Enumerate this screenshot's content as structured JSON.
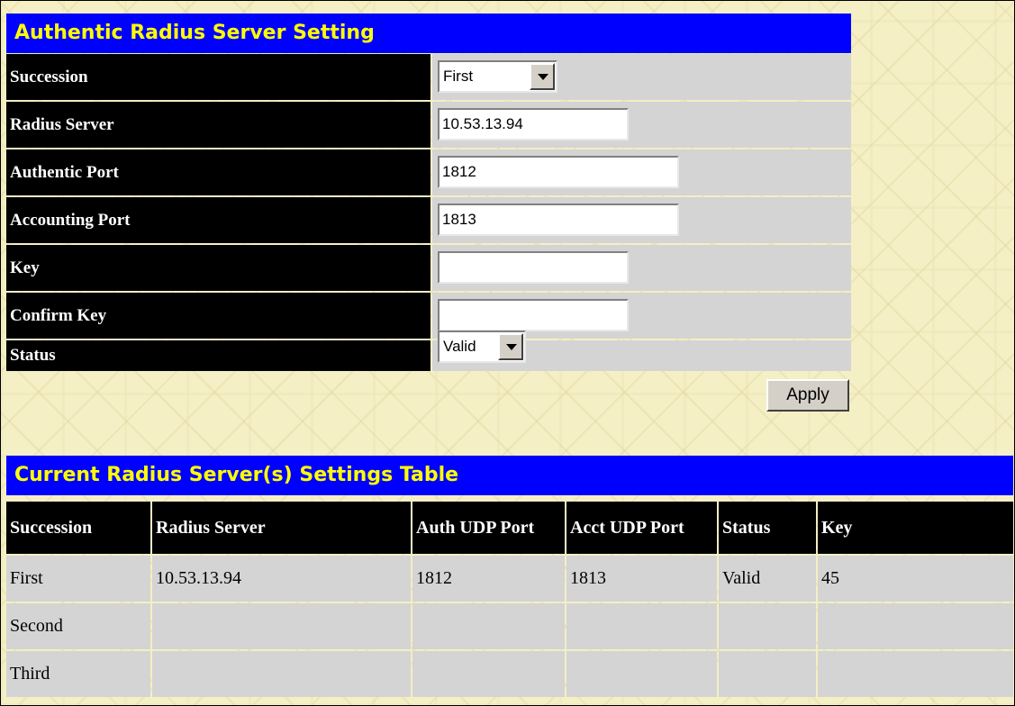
{
  "form": {
    "title": "Authentic Radius Server Setting",
    "fields": [
      {
        "label": "Succession",
        "value": "First"
      },
      {
        "label": "Radius Server",
        "value": "10.53.13.94"
      },
      {
        "label": "Authentic Port",
        "value": "1812"
      },
      {
        "label": "Accounting Port",
        "value": "1813"
      },
      {
        "label": "Key",
        "value": ""
      },
      {
        "label": "Confirm Key",
        "value": ""
      },
      {
        "label": "Status",
        "value": "Valid"
      }
    ],
    "apply_label": "Apply"
  },
  "table": {
    "title": "Current Radius Server(s) Settings Table",
    "headers": [
      "Succession",
      "Radius Server",
      "Auth UDP Port",
      "Acct UDP Port",
      "Status",
      "Key"
    ],
    "rows": [
      [
        "First",
        "10.53.13.94",
        "1812",
        "1813",
        "Valid",
        "45"
      ],
      [
        "Second",
        "",
        "",
        "",
        "",
        ""
      ],
      [
        "Third",
        "",
        "",
        "",
        "",
        ""
      ]
    ]
  },
  "colors": {
    "title_bg": "#0000ff",
    "title_text": "#ffff00",
    "label_bg": "#000000",
    "cell_bg": "#d4d4d4",
    "page_bg": "#f4efc4"
  }
}
